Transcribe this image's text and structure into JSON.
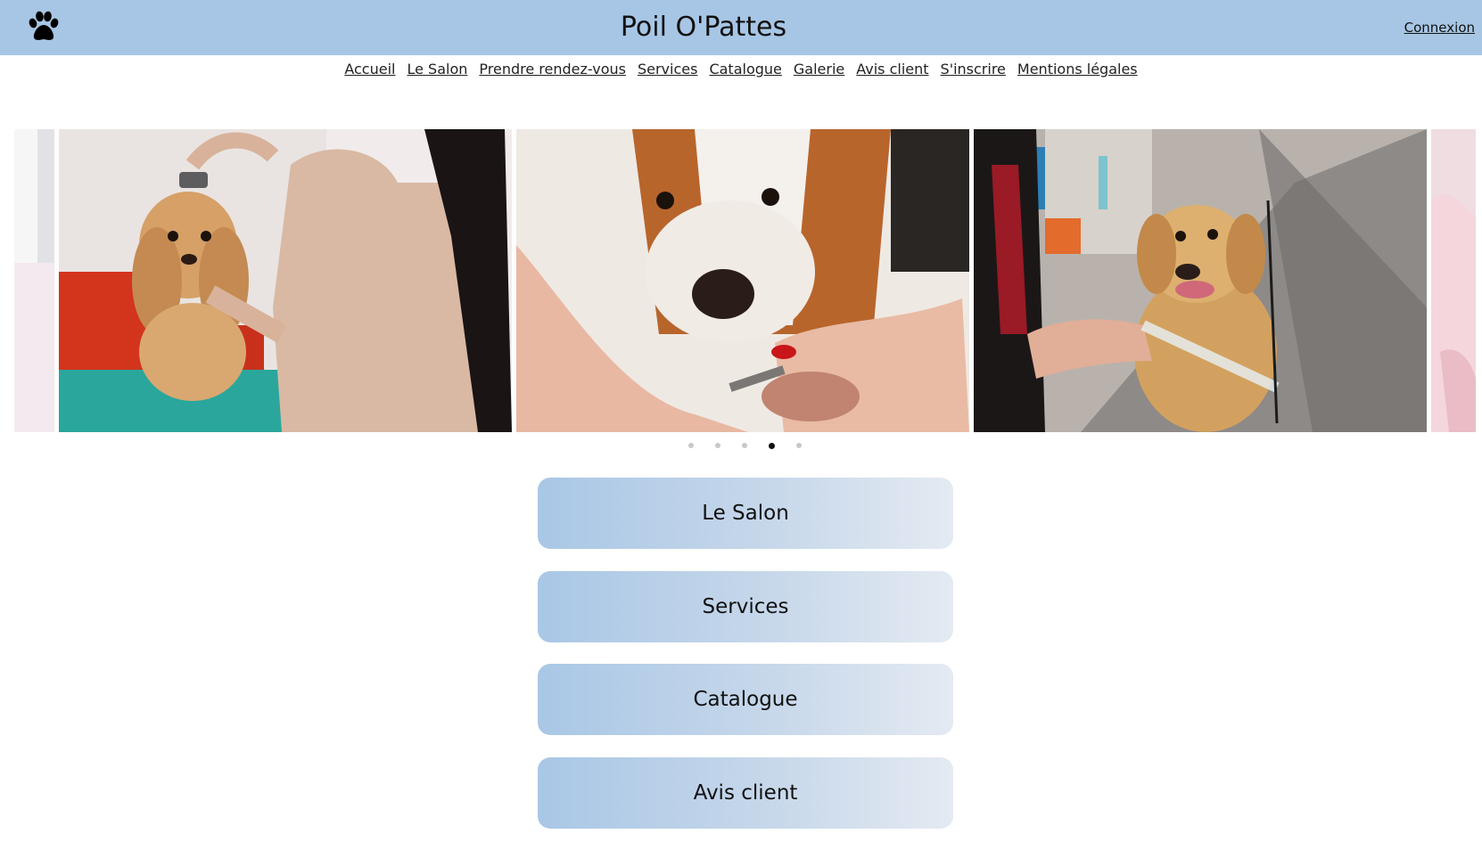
{
  "header": {
    "logo_icon": "paw-icon",
    "title": "Poil O'Pattes",
    "login_label": "Connexion"
  },
  "nav": {
    "items": [
      {
        "label": "Accueil"
      },
      {
        "label": "Le Salon"
      },
      {
        "label": "Prendre rendez-vous"
      },
      {
        "label": "Services"
      },
      {
        "label": "Catalogue"
      },
      {
        "label": "Galerie"
      },
      {
        "label": "Avis client"
      },
      {
        "label": "S'inscrire"
      },
      {
        "label": "Mentions légales"
      }
    ]
  },
  "carousel": {
    "slides": [
      {
        "subject": "cocker-spaniel-grooming-photo"
      },
      {
        "subject": "dog-nail-trimming-photo"
      },
      {
        "subject": "golden-retriever-shower-photo"
      }
    ],
    "dot_count": 5,
    "active_index": 3
  },
  "sections": [
    {
      "label": "Le Salon"
    },
    {
      "label": "Services"
    },
    {
      "label": "Catalogue"
    },
    {
      "label": "Avis client"
    }
  ],
  "colors": {
    "header_bg": "#a7c6e5",
    "button_gradient_start": "#a9c7e6",
    "button_gradient_end": "#e4eaf2"
  }
}
